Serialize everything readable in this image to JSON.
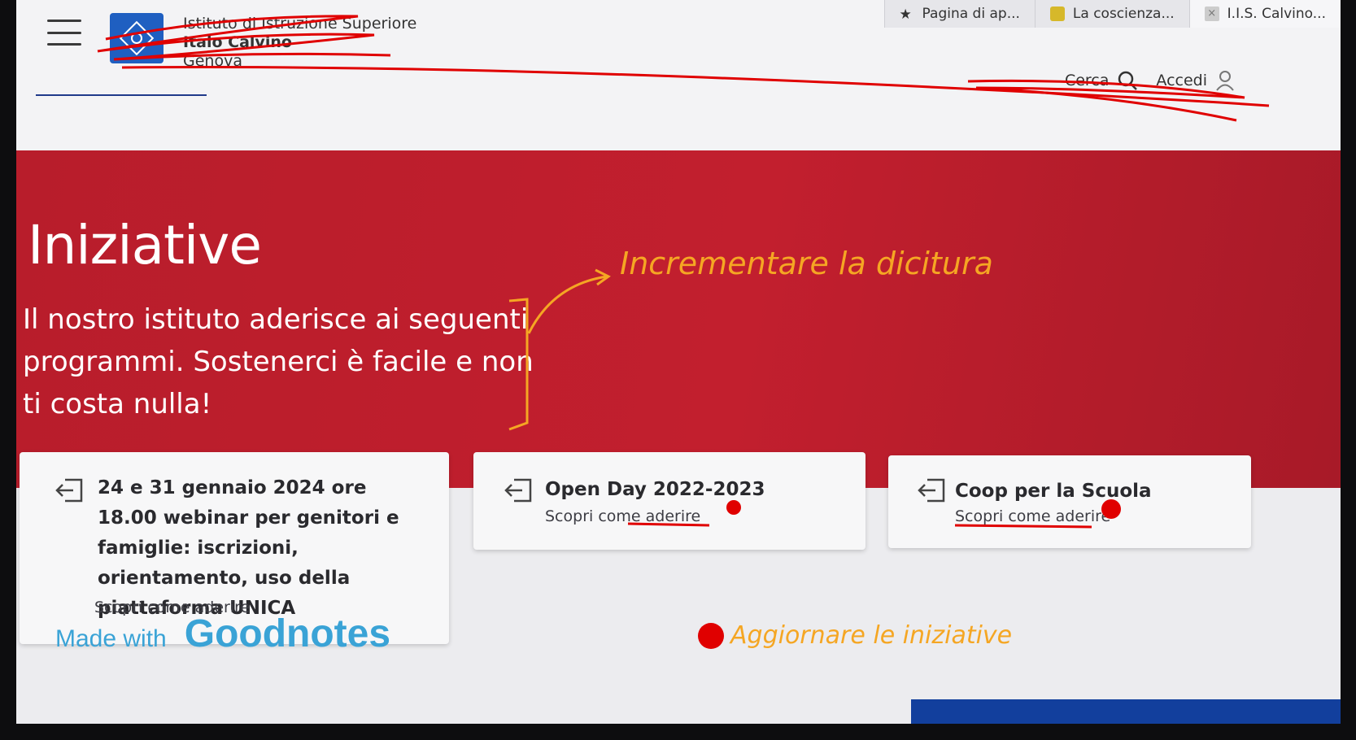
{
  "browser": {
    "tabs": [
      {
        "label": "Pagina di ap..."
      },
      {
        "label": "La coscienza..."
      },
      {
        "label": "I.I.S. Calvino..."
      }
    ]
  },
  "header": {
    "school_line1": "Istituto di Istruzione Superiore",
    "school_line2": "Italo Calvino",
    "school_city": "Genova",
    "search_label": "Cerca",
    "login_label": "Accedi"
  },
  "hero": {
    "title": "Iniziative",
    "subtitle": "Il nostro istituto aderisce ai seguenti programmi. Sostenerci è facile e non ti costa nulla!"
  },
  "cards": [
    {
      "title": "24 e 31 gennaio 2024 ore 18.00 webinar per genitori e famiglie: iscrizioni, orientamento, uso della piattaforma UNICA",
      "link": "Scopri come aderire"
    },
    {
      "title": "Open Day 2022-2023",
      "link": "Scopri come aderire"
    },
    {
      "title": "Coop per la Scuola",
      "link": "Scopri come aderire"
    }
  ],
  "annotations": {
    "note1": "Incrementare la dicitura",
    "note2": "Aggiornare le iniziative",
    "ink_orange": "#f5a623",
    "ink_red": "#e00000"
  },
  "watermark": {
    "small": "Made with",
    "big": "Goodnotes"
  },
  "colors": {
    "hero_red": "#c21f2e",
    "brand_blue": "#1f5fc1"
  }
}
